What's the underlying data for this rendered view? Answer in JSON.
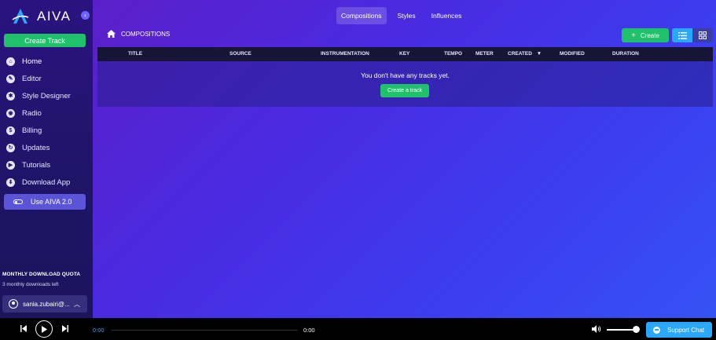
{
  "sidebar": {
    "logo_text": "AIVA",
    "collapse_icon": "‹",
    "create_track_label": "Create Track",
    "items": [
      {
        "label": "Home",
        "icon": "home-icon",
        "glyph": "⌂"
      },
      {
        "label": "Editor",
        "icon": "pencil-icon",
        "glyph": "✎"
      },
      {
        "label": "Style Designer",
        "icon": "style-icon",
        "glyph": "✱"
      },
      {
        "label": "Radio",
        "icon": "radio-icon",
        "glyph": "◉"
      },
      {
        "label": "Billing",
        "icon": "dollar-icon",
        "glyph": "$"
      },
      {
        "label": "Updates",
        "icon": "updates-icon",
        "glyph": "↻"
      },
      {
        "label": "Tutorials",
        "icon": "play-icon",
        "glyph": "▶"
      },
      {
        "label": "Download App",
        "icon": "rocket-icon",
        "glyph": "⬇"
      }
    ],
    "use_aiva_label": "Use AIVA 2.0",
    "quota_title": "MONTHLY DOWNLOAD QUOTA",
    "quota_text": "3 monthly downloads left",
    "user_name": "sania.zubairi@..."
  },
  "main": {
    "tabs": [
      {
        "label": "Compositions",
        "active": true
      },
      {
        "label": "Styles",
        "active": false
      },
      {
        "label": "Influences",
        "active": false
      }
    ],
    "breadcrumb": "COMPOSITIONS",
    "create_label": "Create",
    "columns": [
      "TITLE",
      "SOURCE",
      "INSTRUMENTATION",
      "KEY",
      "TEMPO",
      "METER",
      "CREATED",
      "MODIFIED",
      "DURATION"
    ],
    "sort_indicator": "▼",
    "empty_message": "You don't have any tracks yet.",
    "create_a_track_label": "Create a track"
  },
  "player": {
    "current_time": "0:00",
    "total_time": "0:00",
    "volume": 1.0
  },
  "support_label": "Support Chat",
  "colors": {
    "accent_green": "#1fc16b",
    "accent_blue": "#2aa7ff",
    "sidebar_bg": "#24147a"
  }
}
